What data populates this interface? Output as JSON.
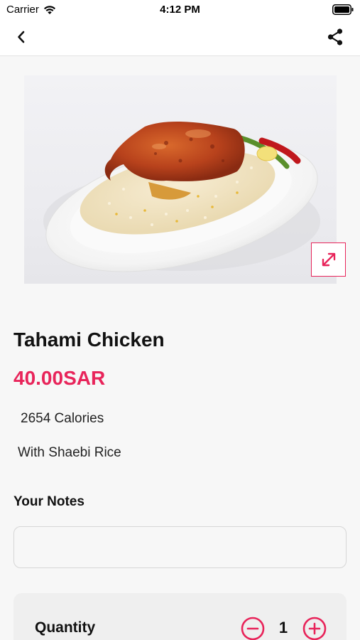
{
  "status_bar": {
    "carrier": "Carrier",
    "time": "4:12 PM"
  },
  "nav": {
    "back_icon": "chevron-left-icon",
    "share_icon": "share-icon"
  },
  "product": {
    "image_icon": "food-photo",
    "expand_icon": "expand-arrows-icon",
    "name": "Tahami Chicken",
    "price": "40.00SAR",
    "calories": "2654 Calories",
    "description": "With Shaebi Rice"
  },
  "notes": {
    "label": "Your Notes",
    "value": "",
    "placeholder": ""
  },
  "quantity": {
    "label": "Quantity",
    "value": "1",
    "minus_icon": "minus-circle-icon",
    "plus_icon": "plus-circle-icon"
  },
  "colors": {
    "accent": "#e8245a",
    "background": "#f7f7f7"
  }
}
